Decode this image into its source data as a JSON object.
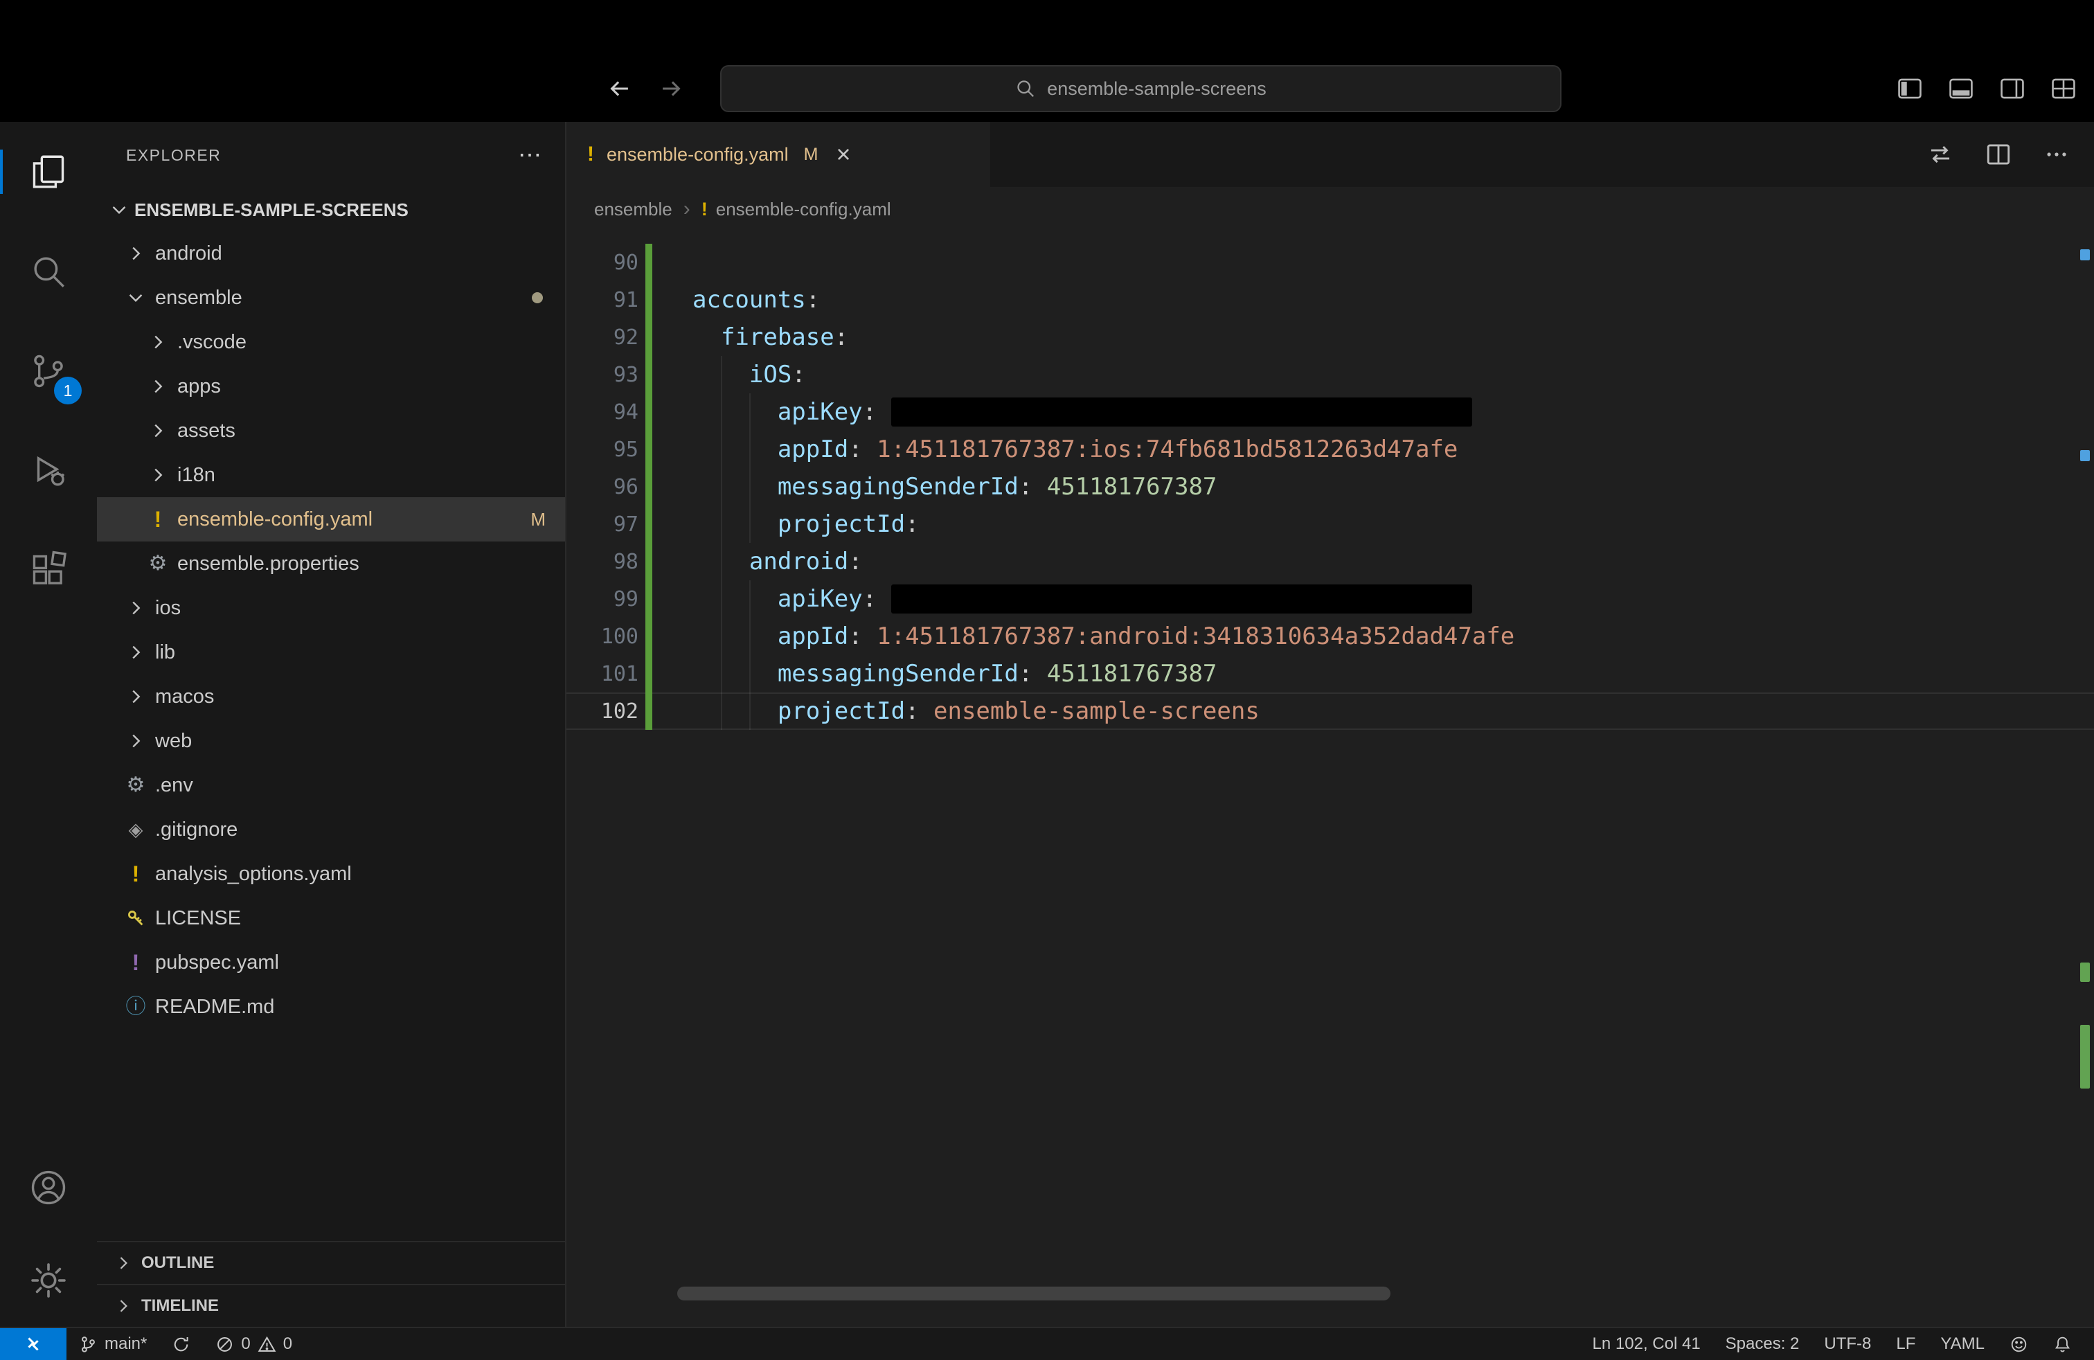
{
  "command_center": {
    "label": "ensemble-sample-screens"
  },
  "activity_bar": {
    "scm_badge": "1"
  },
  "sidebar": {
    "title": "EXPLORER",
    "root_label": "ENSEMBLE-SAMPLE-SCREENS",
    "items": [
      {
        "label": "android",
        "type": "folder",
        "expanded": false,
        "indent": 1
      },
      {
        "label": "ensemble",
        "type": "folder",
        "expanded": true,
        "indent": 1,
        "dot": true
      },
      {
        "label": ".vscode",
        "type": "folder",
        "expanded": false,
        "indent": 2
      },
      {
        "label": "apps",
        "type": "folder",
        "expanded": false,
        "indent": 2
      },
      {
        "label": "assets",
        "type": "folder",
        "expanded": false,
        "indent": 2
      },
      {
        "label": "i18n",
        "type": "folder",
        "expanded": false,
        "indent": 2
      },
      {
        "label": "ensemble-config.yaml",
        "type": "file",
        "icon": "yaml-warning",
        "icon_color": "#ddb100",
        "indent": 2,
        "selected": true,
        "modified": true,
        "badge": "M"
      },
      {
        "label": "ensemble.properties",
        "type": "file",
        "icon": "gear",
        "icon_color": "#9aa0a6",
        "indent": 2
      },
      {
        "label": "ios",
        "type": "folder",
        "expanded": false,
        "indent": 1
      },
      {
        "label": "lib",
        "type": "folder",
        "expanded": false,
        "indent": 1
      },
      {
        "label": "macos",
        "type": "folder",
        "expanded": false,
        "indent": 1
      },
      {
        "label": "web",
        "type": "folder",
        "expanded": false,
        "indent": 1
      },
      {
        "label": ".env",
        "type": "file",
        "icon": "gear",
        "icon_color": "#9aa0a6",
        "indent": 1
      },
      {
        "label": ".gitignore",
        "type": "file",
        "icon": "git",
        "icon_color": "#9e9e9e",
        "indent": 1
      },
      {
        "label": "analysis_options.yaml",
        "type": "file",
        "icon": "yaml-warning",
        "icon_color": "#ddb100",
        "indent": 1
      },
      {
        "label": "LICENSE",
        "type": "file",
        "icon": "key",
        "icon_color": "#d9c749",
        "indent": 1
      },
      {
        "label": "pubspec.yaml",
        "type": "file",
        "icon": "yaml-warning",
        "icon_color": "#9068b0",
        "indent": 1
      },
      {
        "label": "README.md",
        "type": "file",
        "icon": "info",
        "icon_color": "#519aba",
        "indent": 1
      }
    ],
    "sections": [
      {
        "label": "OUTLINE"
      },
      {
        "label": "TIMELINE"
      }
    ]
  },
  "editor": {
    "tab": {
      "label": "ensemble-config.yaml",
      "modified_badge": "M"
    },
    "breadcrumbs": [
      {
        "label": "ensemble"
      },
      {
        "label": "ensemble-config.yaml"
      }
    ],
    "lines": [
      {
        "num": "90",
        "indent": 0,
        "tokens": []
      },
      {
        "num": "91",
        "indent": 0,
        "tokens": [
          {
            "c": "key",
            "t": "accounts"
          },
          {
            "c": "punc",
            "t": ":"
          }
        ]
      },
      {
        "num": "92",
        "indent": 1,
        "tokens": [
          {
            "c": "key",
            "t": "firebase"
          },
          {
            "c": "punc",
            "t": ":"
          }
        ]
      },
      {
        "num": "93",
        "indent": 2,
        "tokens": [
          {
            "c": "key",
            "t": "iOS"
          },
          {
            "c": "punc",
            "t": ":"
          }
        ]
      },
      {
        "num": "94",
        "indent": 3,
        "tokens": [
          {
            "c": "key",
            "t": "apiKey"
          },
          {
            "c": "punc",
            "t": ": "
          },
          {
            "c": "redacted",
            "t": ""
          }
        ]
      },
      {
        "num": "95",
        "indent": 3,
        "tokens": [
          {
            "c": "key",
            "t": "appId"
          },
          {
            "c": "punc",
            "t": ": "
          },
          {
            "c": "str",
            "t": "1:451181767387:ios:74fb681bd5812263d47afe"
          }
        ]
      },
      {
        "num": "96",
        "indent": 3,
        "tokens": [
          {
            "c": "key",
            "t": "messagingSenderId"
          },
          {
            "c": "punc",
            "t": ": "
          },
          {
            "c": "num",
            "t": "451181767387"
          }
        ]
      },
      {
        "num": "97",
        "indent": 3,
        "tokens": [
          {
            "c": "key",
            "t": "projectId"
          },
          {
            "c": "punc",
            "t": ":"
          }
        ]
      },
      {
        "num": "98",
        "indent": 2,
        "tokens": [
          {
            "c": "key",
            "t": "android"
          },
          {
            "c": "punc",
            "t": ":"
          }
        ]
      },
      {
        "num": "99",
        "indent": 3,
        "tokens": [
          {
            "c": "key",
            "t": "apiKey"
          },
          {
            "c": "punc",
            "t": ": "
          },
          {
            "c": "redacted",
            "t": ""
          }
        ]
      },
      {
        "num": "100",
        "indent": 3,
        "tokens": [
          {
            "c": "key",
            "t": "appId"
          },
          {
            "c": "punc",
            "t": ": "
          },
          {
            "c": "str",
            "t": "1:451181767387:android:3418310634a352dad47afe"
          }
        ]
      },
      {
        "num": "101",
        "indent": 3,
        "tokens": [
          {
            "c": "key",
            "t": "messagingSenderId"
          },
          {
            "c": "punc",
            "t": ": "
          },
          {
            "c": "num",
            "t": "451181767387"
          }
        ]
      },
      {
        "num": "102",
        "indent": 3,
        "tokens": [
          {
            "c": "key",
            "t": "projectId"
          },
          {
            "c": "punc",
            "t": ": "
          },
          {
            "c": "str",
            "t": "ensemble-sample-screens"
          }
        ],
        "current": true
      }
    ]
  },
  "status_bar": {
    "branch": "main*",
    "errors": "0",
    "warnings": "0",
    "line_col": "Ln 102, Col 41",
    "indentation": "Spaces: 2",
    "encoding": "UTF-8",
    "eol": "LF",
    "language": "YAML"
  },
  "colors": {
    "accent": "#0078d4",
    "git_modified": "#e2c08d",
    "gutter_modified": "#5a9e3a",
    "redacted": "#000000"
  }
}
